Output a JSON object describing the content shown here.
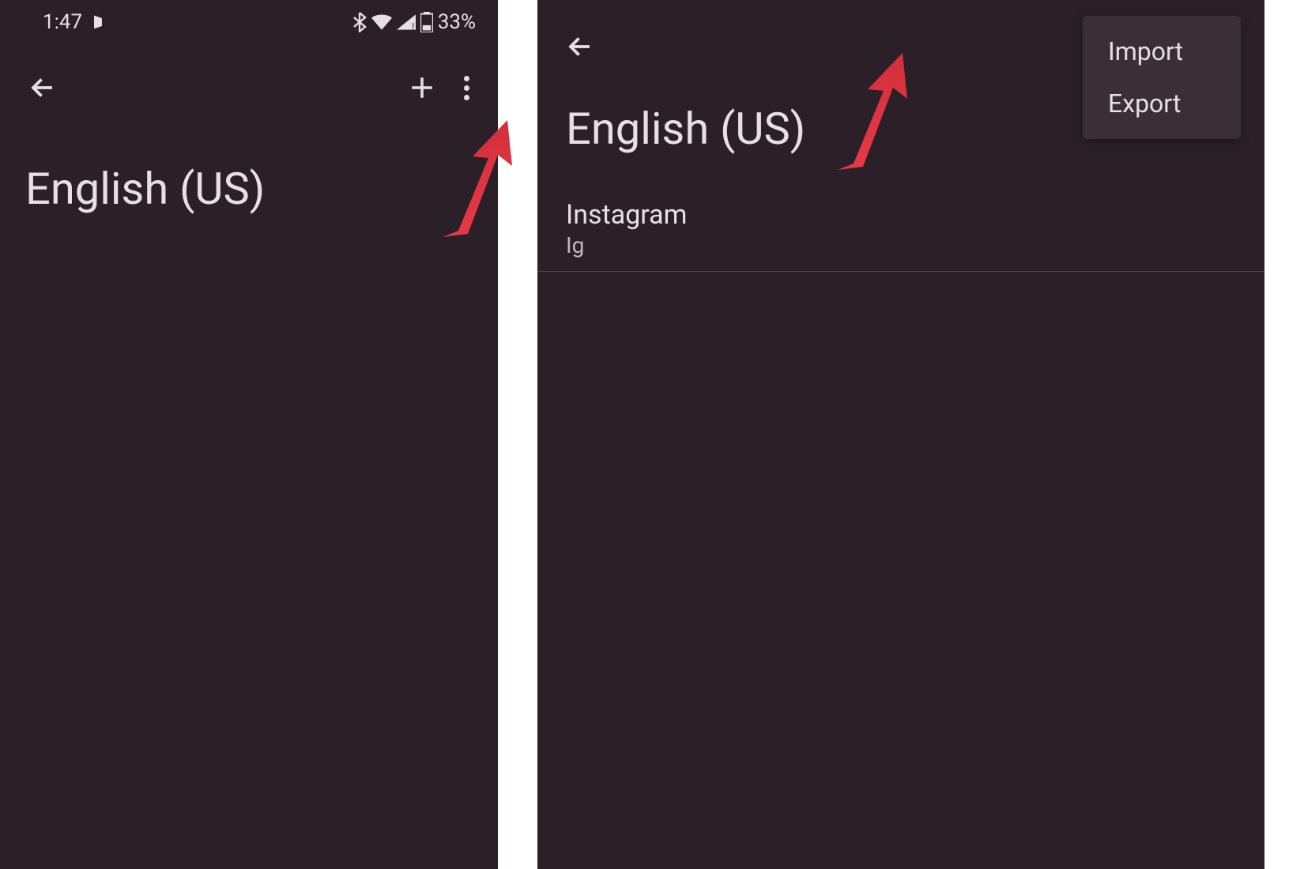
{
  "status_bar": {
    "time": "1:47",
    "battery_text": "33%"
  },
  "left_screen": {
    "title": "English (US)"
  },
  "right_screen": {
    "title": "English (US)",
    "menu": {
      "import": "Import",
      "export": "Export"
    },
    "items": [
      {
        "title": "Instagram",
        "subtitle": "Ig"
      }
    ]
  }
}
